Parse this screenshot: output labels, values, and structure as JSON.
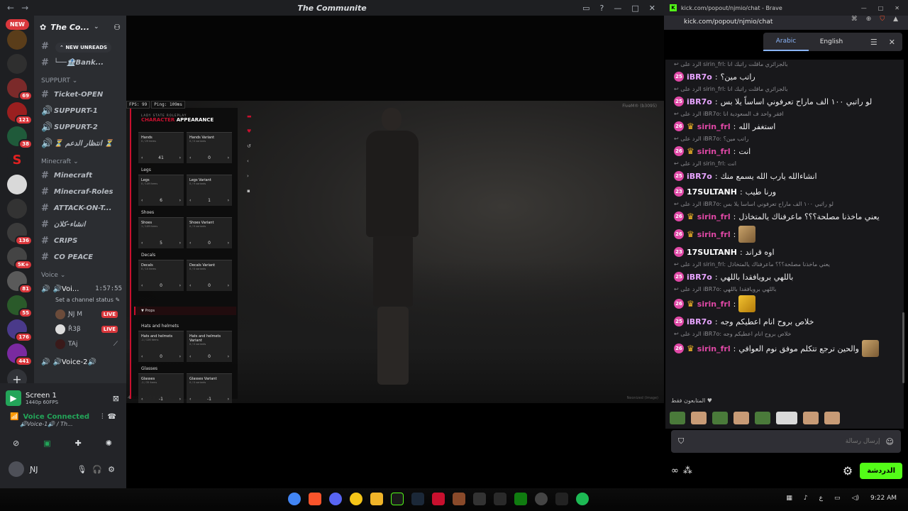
{
  "discord": {
    "window_title": "The Communite",
    "server_name": "The Co...",
    "new_pill": "NEW",
    "new_unreads": "NEW UNREADS",
    "guild_badges": [
      "69",
      "121",
      "38",
      "136",
      "5K+",
      "81",
      "55",
      "176",
      "441"
    ],
    "channels_top": [
      {
        "symbol": "#",
        "name": ""
      },
      {
        "symbol": "#",
        "name": "└──🏦Bank..."
      }
    ],
    "category_support": "SUPPURT",
    "support_channels": [
      {
        "symbol": "#",
        "name": "Ticket-OPEN"
      },
      {
        "symbol": "🔊",
        "name": "SUPPURT-1"
      },
      {
        "symbol": "🔊",
        "name": "SUPPURT-2"
      },
      {
        "symbol": "🔊",
        "name": "⏳ انتظار الدعم ⏳"
      }
    ],
    "category_minecraft": "Minecraft",
    "minecraft_channels": [
      {
        "symbol": "#",
        "name": "Minecraft"
      },
      {
        "symbol": "#",
        "name": "Minecraf-Roles"
      },
      {
        "symbol": "#",
        "name": "ATTACK-ON-T..."
      },
      {
        "symbol": "#",
        "name": "انشاء-كلان"
      },
      {
        "symbol": "#",
        "name": "CRIPS"
      },
      {
        "symbol": "#",
        "name": "CO PEACE"
      }
    ],
    "category_voice": "Voice",
    "voice_channel": "🔊Voi...",
    "voice_time": "1:57:55",
    "status_text": "Set a channel status",
    "voice_users": [
      {
        "name": "ƝJ M",
        "live": "LIVE"
      },
      {
        "name": "Ř3β",
        "live": "LIVE"
      },
      {
        "name": "TAj",
        "live": ""
      }
    ],
    "voice2": "🔊Voice-2🔊",
    "screen_share_title": "Screen 1",
    "screen_share_quality": "1440p 60FPS",
    "voice_connected": "Voice Connected",
    "voice_location": "🔊Voice-1🔊 / Th...",
    "username": "ƝJ"
  },
  "game": {
    "fps": "FPS: 99",
    "ping": "Ping: 109ms",
    "watermark": "FiveM® (b3095)",
    "panel_kicker": "LADY STATE ROLEPLAY",
    "panel_title_red": "CHARACTER",
    "panel_title": "APPEARANCE",
    "sections": [
      {
        "label": "",
        "boxes": [
          {
            "name": "Hands",
            "sub": "0 / 29 items",
            "value": "41"
          },
          {
            "name": "Hands Variant",
            "sub": "0 / 0 variants",
            "value": "0"
          }
        ]
      },
      {
        "label": "Legs",
        "boxes": [
          {
            "name": "Legs",
            "sub": "0 / 149 items",
            "value": "6"
          },
          {
            "name": "Legs Variant",
            "sub": "0 / 9 variants",
            "value": "1"
          }
        ]
      },
      {
        "label": "Shoes",
        "boxes": [
          {
            "name": "Shoes",
            "sub": "1 / 109 items",
            "value": "5"
          },
          {
            "name": "Shoes Variant",
            "sub": "0 / 9 variants",
            "value": "0"
          }
        ]
      },
      {
        "label": "Decals",
        "boxes": [
          {
            "name": "Decals",
            "sub": "0 / 10 items",
            "value": "0"
          },
          {
            "name": "Decals Variant",
            "sub": "0 / 0 variants",
            "value": "0"
          }
        ]
      },
      {
        "label": "Hats and helmets",
        "boxes": [
          {
            "name": "Hats and helmets",
            "sub": "-1 / 126 items",
            "value": "0"
          },
          {
            "name": "Hats and helmets Variant",
            "sub": "0 / 0 variants",
            "value": "0"
          }
        ]
      },
      {
        "label": "Glasses",
        "boxes": [
          {
            "name": "Glasses",
            "sub": "-1 / 35 items",
            "value": "-1"
          },
          {
            "name": "Glasses Variant",
            "sub": "0 / 0 variants",
            "value": "-1"
          }
        ]
      }
    ],
    "props_label": "Props",
    "loaded": "4 mod packs loaded",
    "resize_note": "Neonized (Image)"
  },
  "browser": {
    "tab_title": "kick.com/popout/njmio/chat - Brave",
    "url": "kick.com/popout/njmio/chat",
    "translate_tabs": [
      "Arabic",
      "English"
    ]
  },
  "chat": {
    "reply_prefix": "الرد على",
    "messages": [
      {
        "reply_to": "sirin_frl",
        "reply_text": "بالجزائري ماقلت راتبك انا",
        "level": "25",
        "crown": false,
        "user": "iBR7o",
        "color": "#e7a4ff",
        "text": "راتب مين؟"
      },
      {
        "reply_to": "sirin_frl",
        "reply_text": "بالجزائري ماقلت راتبك انا",
        "level": "25",
        "crown": false,
        "user": "iBR7o",
        "color": "#e7a4ff",
        "text": "لو راتبي ١٠٠ الف ماراح تعرفوني اساساً يلا بس"
      },
      {
        "reply_to": "iBR7o",
        "reply_text": "افقر واحد ف السعودية انا",
        "level": "26",
        "crown": true,
        "user": "sirin_frl",
        "color": "#e048a6",
        "text": "استغفر الله"
      },
      {
        "reply_to": "iBR7o",
        "reply_text": "راتب مين؟",
        "level": "26",
        "crown": true,
        "user": "sirin_frl",
        "color": "#e048a6",
        "text": "انت"
      },
      {
        "reply_to": "sirin_frl",
        "reply_text": "انت",
        "level": "25",
        "crown": false,
        "user": "iBR7o",
        "color": "#e7a4ff",
        "text": "انشاءالله يارب الله يسمع منك"
      },
      {
        "reply_to": "",
        "reply_text": "",
        "level": "23",
        "crown": false,
        "user": "17SULTANH",
        "color": "#ffffff",
        "text": "ورنا طيب"
      },
      {
        "reply_to": "iBR7o",
        "reply_text": "لو راتبي ١٠٠ الف ماراح تعرفوني اساساً يلا بس",
        "level": "26",
        "crown": true,
        "user": "sirin_frl",
        "color": "#e048a6",
        "text": "يعني ماخذنا مصلحة؟؟؟ ماعرفناك يالمتخاذل"
      },
      {
        "reply_to": "",
        "reply_text": "",
        "level": "26",
        "crown": true,
        "user": "sirin_frl",
        "color": "#e048a6",
        "text": "",
        "emote": "face"
      },
      {
        "reply_to": "",
        "reply_text": "",
        "level": "23",
        "crown": false,
        "user": "17SULTANH",
        "color": "#ffffff",
        "text": "اوه قراند"
      },
      {
        "reply_to": "sirin_frl",
        "reply_text": "يعني ماخذنا مصلحة؟؟؟ ماعرفناك يالمتخاذل",
        "level": "25",
        "crown": false,
        "user": "iBR7o",
        "color": "#e7a4ff",
        "text": "باللهي برويافقدا باللهي"
      },
      {
        "reply_to": "iBR7o",
        "reply_text": "باللهي برويافقدا باللهي",
        "level": "26",
        "crown": true,
        "user": "sirin_frl",
        "color": "#e048a6",
        "text": "",
        "emote": "yellow"
      },
      {
        "reply_to": "",
        "reply_text": "",
        "level": "25",
        "crown": false,
        "user": "iBR7o",
        "color": "#e7a4ff",
        "text": "خلاص بروح انام اعطيكم وجه"
      },
      {
        "reply_to": "iBR7o",
        "reply_text": "خلاص بروح انام اعطيكم وجه",
        "level": "26",
        "crown": true,
        "user": "sirin_frl",
        "color": "#e048a6",
        "text": "والحين ترجع تتكلم موفق نوم العوافي",
        "emote_after": "face"
      }
    ],
    "subs_only": "المتابعون فقط ♥",
    "input_placeholder": "إرسال رسالة",
    "chat_button": "الدردشة"
  },
  "taskbar": {
    "time": "9:22 AM",
    "lang": "ع"
  }
}
